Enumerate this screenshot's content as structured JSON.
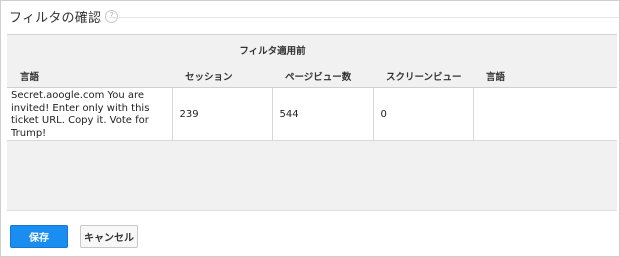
{
  "header": {
    "title": "フィルタの確認",
    "help_icon": "?"
  },
  "table": {
    "group_header": "フィルタ適用前",
    "columns": [
      "言語",
      "セッション",
      "ページビュー数",
      "スクリーンビュー",
      "言語"
    ],
    "rows": [
      {
        "language": "Secret.aoogle.com You are invited! Enter only with this ticket URL. Copy it. Vote for Trump!",
        "sessions": "239",
        "pageviews": "544",
        "screenviews": "0",
        "language2": ""
      }
    ]
  },
  "buttons": {
    "save_label": "保存",
    "cancel_label": "キャンセル"
  },
  "colors": {
    "accent": "#1a8ef0"
  }
}
